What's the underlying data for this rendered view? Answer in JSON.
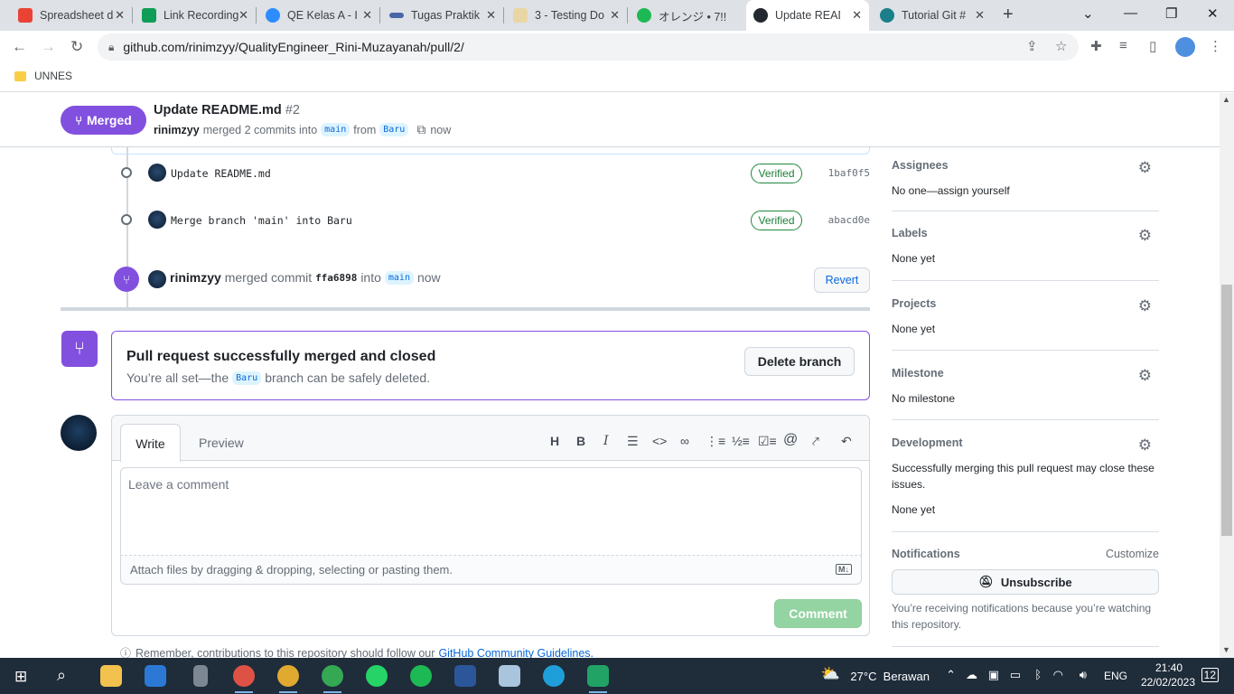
{
  "browser": {
    "tabs": [
      {
        "title": "Spreadsheet d",
        "favicon": "gmail-icon",
        "color": "#ea4335"
      },
      {
        "title": "Link Recording",
        "favicon": "sheets-icon",
        "color": "#0f9d58"
      },
      {
        "title": "QE Kelas A - I",
        "favicon": "zoom-icon",
        "color": "#2d8cff"
      },
      {
        "title": "Tugas Praktik",
        "favicon": "doc-icon",
        "color": "#4b66a8"
      },
      {
        "title": "3 - Testing Do",
        "favicon": "notes-icon",
        "color": "#c7a24a"
      },
      {
        "title": "オレンジ • 7!!",
        "favicon": "spotify-icon",
        "color": "#1db954"
      },
      {
        "title": "Update READ",
        "favicon": "github-icon",
        "color": "#24292f"
      },
      {
        "title": "Tutorial Git #",
        "favicon": "tutorial-icon",
        "color": "#1a7f8a"
      }
    ],
    "url": "github.com/rinimzyy/QualityEngineer_Rini-Muzayanah/pull/2/",
    "bookmark": "UNNES"
  },
  "pr": {
    "state": "Merged",
    "title": "Update README.md",
    "number": "#2",
    "author": "rinimzyy",
    "merged_text": "merged 2 commits into",
    "base_branch": "main",
    "from_text": "from",
    "head_branch": "Baru",
    "time": "now"
  },
  "commits": [
    {
      "message": "Update README.md",
      "badge": "Verified",
      "sha": "1baf0f5"
    },
    {
      "message": "Merge branch 'main' into Baru",
      "badge": "Verified",
      "sha": "abacd0e"
    }
  ],
  "merge_event": {
    "user": "rinimzyy",
    "text": "merged commit",
    "sha": "ffa6898",
    "into": "into",
    "branch": "main",
    "time": "now",
    "revert": "Revert"
  },
  "merged_box": {
    "heading": "Pull request successfully merged and closed",
    "sub_before": "You’re all set—the",
    "branch": "Baru",
    "sub_after": "branch can be safely deleted.",
    "button": "Delete branch"
  },
  "comment": {
    "tab_write": "Write",
    "tab_preview": "Preview",
    "placeholder": "Leave a comment",
    "attach": "Attach files by dragging & dropping, selecting or pasting them.",
    "md_badge": "M↓",
    "submit": "Comment",
    "remember": "Remember, contributions to this repository should follow our",
    "guidelines": "GitHub Community Guidelines."
  },
  "sidebar": {
    "assignees": {
      "label": "Assignees",
      "value": "No one—assign yourself"
    },
    "labels": {
      "label": "Labels",
      "value": "None yet"
    },
    "projects": {
      "label": "Projects",
      "value": "None yet"
    },
    "milestone": {
      "label": "Milestone",
      "value": "No milestone"
    },
    "development": {
      "label": "Development",
      "value": "Successfully merging this pull request may close these issues.",
      "value2": "None yet"
    },
    "notifications": {
      "label": "Notifications",
      "customize": "Customize",
      "unsubscribe": "Unsubscribe",
      "note": "You’re receiving notifications because you’re watching this repository."
    }
  },
  "taskbar": {
    "weather": "27°C  Berawan",
    "lang": "ENG",
    "time": "21:40",
    "date": "22/02/2023",
    "notif_count": "12"
  }
}
